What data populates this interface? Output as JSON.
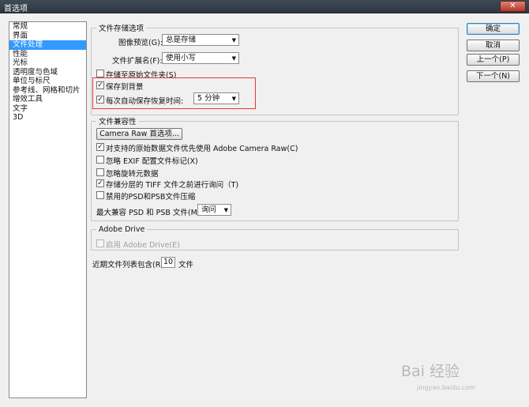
{
  "window": {
    "title": "首选项",
    "close_glyph": "✕"
  },
  "sidebar": {
    "items": [
      "常规",
      "界面",
      "文件处理",
      "性能",
      "光标",
      "透明度与色域",
      "单位与标尺",
      "参考线、网格和切片",
      "增效工具",
      "文字",
      "3D"
    ],
    "active_index": 2
  },
  "file_saving": {
    "legend": "文件存储选项",
    "image_preview_label": "图像预览(G):",
    "image_preview_value": "总是存储",
    "extension_label": "文件扩展名(F):",
    "extension_value": "使用小写",
    "save_subfolder_label": "存储至原始文件夹(S)",
    "save_subfolder_checked": false,
    "save_background_label": "保存到背景",
    "save_background_checked": true,
    "autosave_label": "每次自动保存恢复时间:",
    "autosave_checked": true,
    "autosave_value": "5 分钟",
    "check_glyph": "✓",
    "caret_glyph": "▼"
  },
  "compat": {
    "legend": "文件兼容性",
    "camera_raw_button": "Camera Raw 首选项...",
    "options": [
      {
        "label": "对支持的原始数据文件优先使用 Adobe Camera Raw(C)",
        "checked": true
      },
      {
        "label": "忽略 EXIF 配置文件标记(X)",
        "checked": false
      },
      {
        "label": "忽略旋转元数据",
        "checked": false
      },
      {
        "label": "存储分层的 TIFF 文件之前进行询问（T)",
        "checked": true
      },
      {
        "label": "禁用的PSD和PSB文件压缩",
        "checked": false
      }
    ],
    "max_compat_label": "最大兼容 PSD 和 PSB 文件(M):",
    "max_compat_value": "询问"
  },
  "adobe_drive": {
    "legend": "Adobe Drive",
    "enable_label": "启用 Adobe Drive(E)",
    "enable_checked": false
  },
  "recent": {
    "label": "近期文件列表包含(R):",
    "value": "10",
    "unit": "文件"
  },
  "buttons": {
    "ok": "确定",
    "cancel": "取消",
    "prev": "上一个(P)",
    "next": "下一个(N)"
  },
  "watermark": {
    "main": "Bai 经验",
    "sub": "jingyan.baidu.com"
  }
}
